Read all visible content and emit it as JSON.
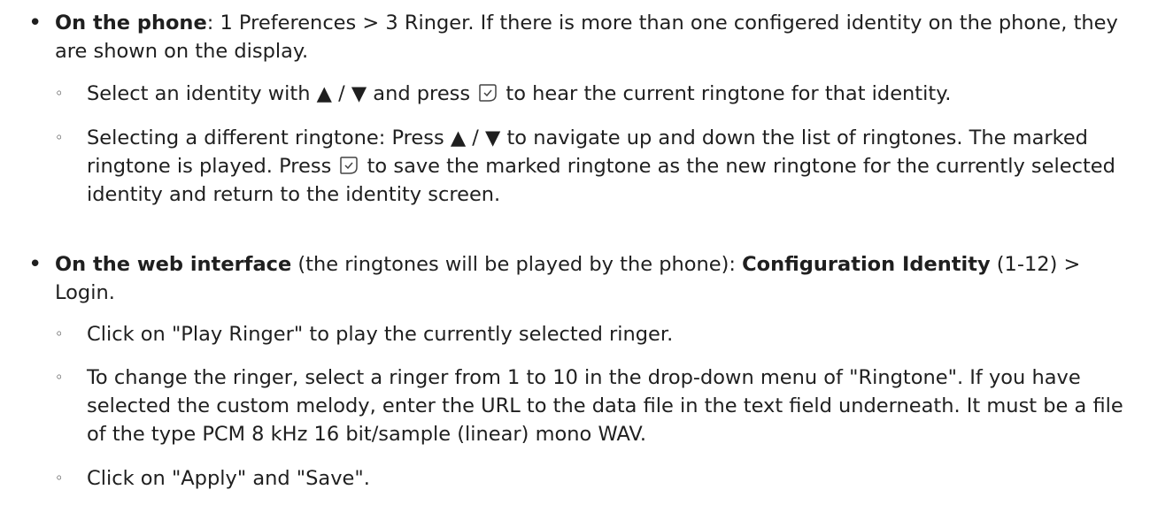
{
  "phone_section": {
    "bullet": "•",
    "heading": "On the phone",
    "text": ": 1 Preferences > 3 Ringer. If there is more than one configered identity on the phone, they are shown on the display.",
    "sub_bullet": "◦",
    "item1_a": "Select an identity with ▲ / ▼ and press ",
    "item1_b": " to hear the current ringtone for that identity.",
    "item2_a": "Selecting a different ringtone: Press ▲ / ▼ to navigate up and down the list of ringtones. The marked ringtone is played. Press ",
    "item2_b": " to save the marked ringtone as the new ringtone for the currently selected identity and return to the identity screen."
  },
  "web_section": {
    "bullet": "•",
    "heading": "On the web interface",
    "text_a": " (the ringtones will be played by the phone): ",
    "heading2": "Configuration Identity",
    "text_b": " (1-12) > Login.",
    "sub_bullet": "◦",
    "item1": "Click on \"Play Ringer\" to play the currently selected ringer.",
    "item2": "To change the ringer, select a ringer from 1 to 10 in the drop-down menu of \"Ringtone\". If you have selected the custom melody, enter the URL to the data file in the text field underneath. It must be a file of the type PCM 8 kHz 16 bit/sample (linear) mono WAV.",
    "item3": "Click on \"Apply\" and \"Save\"."
  },
  "icons": {
    "ok_key": "ok-key-icon"
  }
}
